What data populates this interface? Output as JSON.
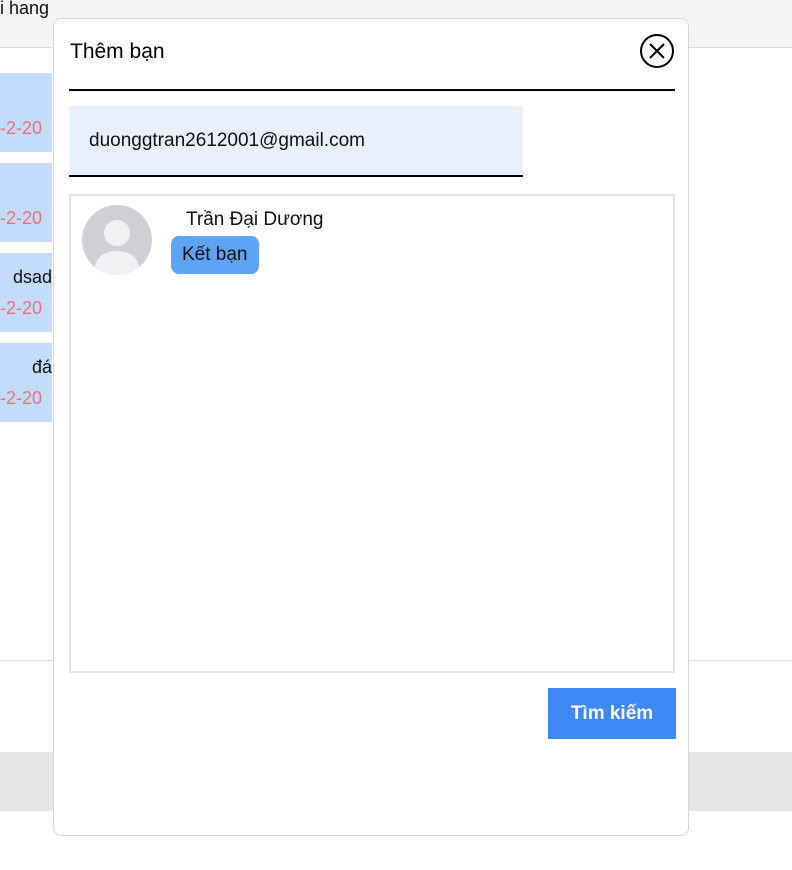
{
  "background": {
    "topbar_text": "i hang",
    "items": [
      {
        "text": "",
        "date": "-2-20"
      },
      {
        "text": "",
        "date": "-2-20"
      },
      {
        "text": "dsad",
        "date": "-2-20"
      },
      {
        "text": "đá",
        "date": "-2-20"
      }
    ]
  },
  "modal": {
    "title": "Thêm bạn",
    "close_icon": "close-circle-icon",
    "search": {
      "value": "duonggtran2612001@gmail.com"
    },
    "results": [
      {
        "name": "Trần Đại Dương",
        "avatar_icon": "default-user-avatar-icon",
        "action_label": "Kết bạn"
      }
    ],
    "search_button_label": "Tìm kiếm"
  },
  "colors": {
    "accent": "#3e88f7",
    "friend_button": "#5fa3f4",
    "input_bg": "#e8f0fd",
    "list_item_bg": "#c4dcfb",
    "date_text": "#ef6f78"
  }
}
